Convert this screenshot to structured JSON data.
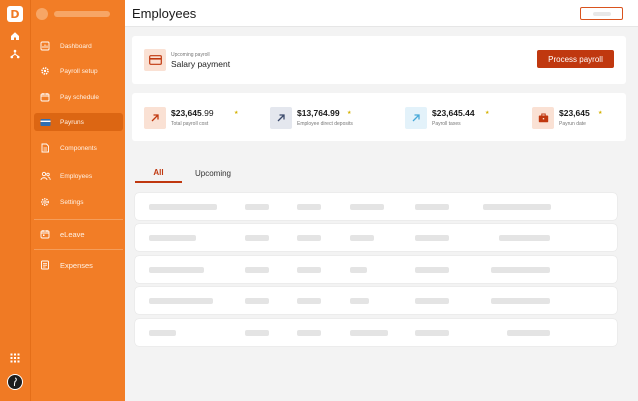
{
  "app": {
    "logo_letter": "D"
  },
  "rail": {
    "icons": [
      "home-icon",
      "org-chart-icon",
      "apps-grid-icon",
      "user-avatar"
    ]
  },
  "sidebar": {
    "items": [
      {
        "label": "Dashboard",
        "icon": "dashboard-icon",
        "active": false
      },
      {
        "label": "Payroll setup",
        "icon": "gear-icon",
        "active": false
      },
      {
        "label": "Pay schedule",
        "icon": "calendar-icon",
        "active": false
      },
      {
        "label": "Payruns",
        "icon": "payrun-card-icon",
        "active": true
      },
      {
        "label": "Components",
        "icon": "document-icon",
        "active": false
      },
      {
        "label": "Employees",
        "icon": "people-icon",
        "active": false
      },
      {
        "label": "Settings",
        "icon": "settings-icon",
        "active": false
      },
      {
        "label": "eLeave",
        "icon": "leave-calendar-icon",
        "active": false
      },
      {
        "label": "Expenses",
        "icon": "receipt-icon",
        "active": false
      }
    ]
  },
  "header": {
    "title": "Employees"
  },
  "payroll": {
    "subtitle": "Upcoming payroll",
    "title": "Salary payment",
    "button": "Process payroll"
  },
  "stats": [
    {
      "whole": "$23,645",
      "cents": ".99",
      "label": "Total payroll cost",
      "icon": "arrow-up-right-icon",
      "color": "#c0380f"
    },
    {
      "whole": "$13,764.99",
      "cents": "",
      "label": "Employee direct deposits",
      "icon": "arrow-up-right-icon",
      "color": "#3b4a6b"
    },
    {
      "whole": "$23,645.44",
      "cents": "",
      "label": "Payroll taxes",
      "icon": "arrow-up-right-icon",
      "color": "#47a9d8"
    },
    {
      "whole": "$23,645",
      "cents": "",
      "label": "Payrun date",
      "icon": "briefcase-icon",
      "color": "#c0380f"
    }
  ],
  "tabs": {
    "all": "All",
    "upcoming": "Upcoming"
  },
  "colors": {
    "accent": "#c0380f",
    "sidebar": "#f27d26",
    "rail": "#f07a24"
  }
}
